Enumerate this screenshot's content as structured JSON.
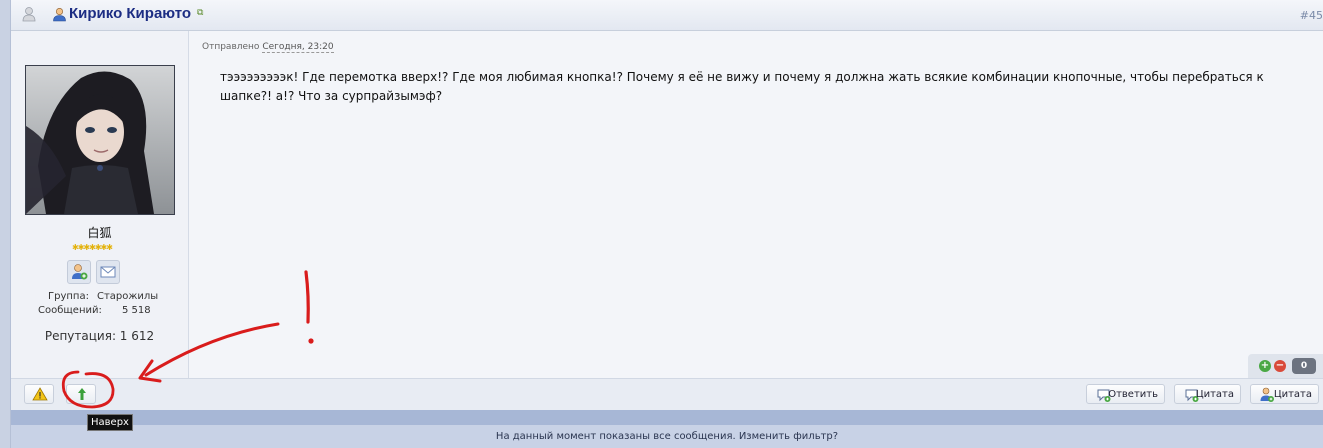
{
  "post": {
    "author_name": "Кирико Кираюто",
    "post_number": "#45",
    "sent_label": "Отправлено",
    "sent_date": "Сегодня, 23:20",
    "body": "тэээээээээк! Где перемотка вверх!? Где моя любимая кнопка!? Почему я её не вижу и почему я должна жать всякие комбинации кнопочные, чтобы перебраться к шапке?! а!? Что за сурпрайзымэф?"
  },
  "author": {
    "nickname": "白狐",
    "stars": "✱✱✱✱✱✱✱",
    "group_label": "Группа:",
    "group_value": "Старожилы",
    "posts_label": "Сообщений:",
    "posts_value": "5 518",
    "reputation": "Репутация: 1 612"
  },
  "rating": {
    "plus": "+",
    "minus": "−",
    "count": "0"
  },
  "buttons": {
    "reply": "Ответить",
    "quote": "Цитата",
    "quote_user": "Цитата"
  },
  "annotation": {
    "mark": "!"
  },
  "tooltip": "Наверх",
  "footer": "На данный момент показаны все сообщения. Изменить фильтр?",
  "colors": {
    "username": "#1c2d83",
    "annotation_red": "#d91c1c",
    "up_arrow_green": "#3ba03b"
  },
  "icons": [
    "status-icon",
    "user-icon",
    "external-link-icon",
    "profile-icon",
    "message-icon",
    "warning-icon",
    "up-arrow-icon",
    "reply-icon",
    "quote-icon",
    "quote-user-icon"
  ]
}
